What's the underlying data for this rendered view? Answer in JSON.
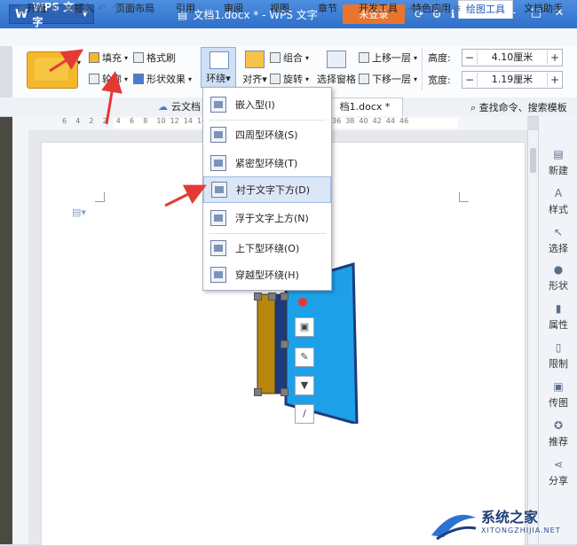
{
  "title_bar": {
    "app_button": "WPS 文字",
    "doc_title": "文档1.docx * - WPS 文字",
    "login_label": "未登录"
  },
  "tabs": [
    "开始",
    "插入",
    "页面布局",
    "引用",
    "审阅",
    "视图",
    "章节",
    "开发工具",
    "特色应用",
    "绘图工具",
    "文档助手"
  ],
  "active_tab": "绘图工具",
  "ribbon": {
    "fill_label": "填充",
    "format_brush_label": "格式刷",
    "outline_label": "轮廓",
    "shape_effect_label": "形状效果",
    "wrap_label": "环绕",
    "align_label": "对齐",
    "group_label": "组合",
    "rotate_label": "旋转",
    "select_pane_label": "选择窗格",
    "bring_forward_label": "上移一层",
    "send_backward_label": "下移一层",
    "height_label": "高度:",
    "height_value": "4.10厘米",
    "width_label": "宽度:",
    "width_value": "1.19厘米"
  },
  "quick_bar": {
    "cloud_label": "云文档",
    "doc_tab_label": "档1.docx *",
    "search_label": "查找命令、搜索模板"
  },
  "ruler_ticks": [
    "6",
    "4",
    "2",
    "2",
    "4",
    "6",
    "8",
    "10",
    "12",
    "14",
    "16",
    "18",
    "20",
    "22",
    "24",
    "26",
    "28",
    "30",
    "32",
    "34",
    "36",
    "38",
    "40",
    "42",
    "44",
    "46"
  ],
  "wrap_menu": {
    "items": [
      {
        "label": "嵌入型(I)",
        "selected": false
      },
      {
        "label": "四周型环绕(S)",
        "selected": false
      },
      {
        "label": "紧密型环绕(T)",
        "selected": false
      },
      {
        "label": "衬于文字下方(D)",
        "selected": true
      },
      {
        "label": "浮于文字上方(N)",
        "selected": false
      },
      {
        "label": "上下型环绕(O)",
        "selected": false
      },
      {
        "label": "穿越型环绕(H)",
        "selected": false
      }
    ]
  },
  "right_panel": [
    "新建",
    "样式",
    "选择",
    "形状",
    "属性",
    "限制",
    "传图",
    "推荐",
    "分享"
  ],
  "watermark": {
    "title": "系统之家",
    "url": "XITONGZHIJIA.NET"
  },
  "colors": {
    "title_bar": "#3a7bd5",
    "login": "#e8742f",
    "door_light": "#1ea0e8",
    "door_dark": "#1d3b7a",
    "door_gold": "#b8860b",
    "arrow": "#e53935",
    "selection": "#dbe6f7"
  }
}
